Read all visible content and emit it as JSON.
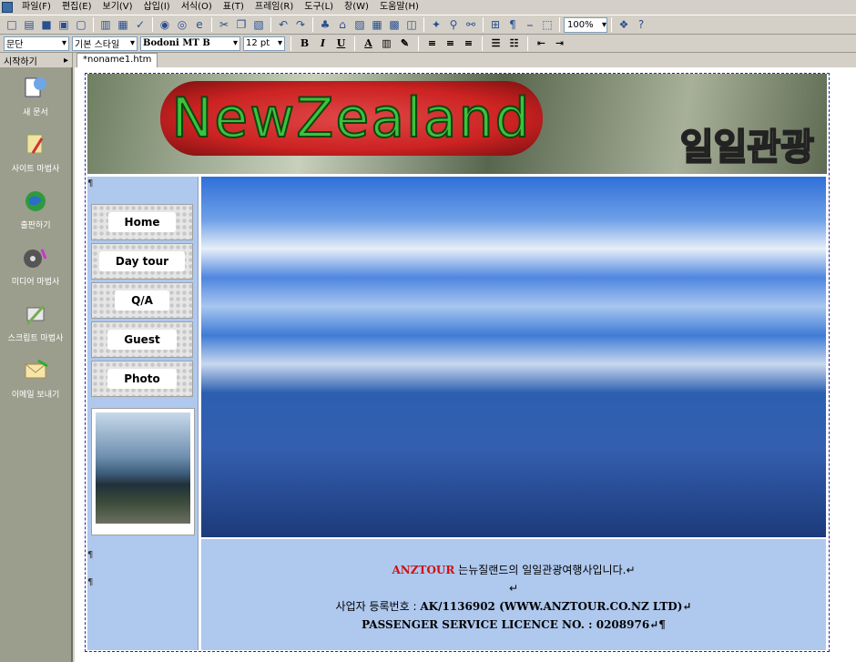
{
  "menu": [
    "파일(F)",
    "편집(E)",
    "보기(V)",
    "삽입(I)",
    "서식(O)",
    "표(T)",
    "프레임(R)",
    "도구(L)",
    "창(W)",
    "도움말(H)"
  ],
  "toolbar": {
    "zoom": "100%"
  },
  "format": {
    "paragraph": "문단",
    "style": "기본 스타일",
    "font": "Bodoni MT B",
    "size": "12 pt",
    "bold": "B",
    "italic": "I",
    "underline": "U"
  },
  "tabs": {
    "start": "시작하기",
    "document": "*noname1.htm"
  },
  "sidebar": [
    {
      "label": "새 문서",
      "icon": "new-document-icon"
    },
    {
      "label": "사이트 마법사",
      "icon": "site-wizard-icon"
    },
    {
      "label": "출판하기",
      "icon": "publish-globe-icon"
    },
    {
      "label": "미디어 마법사",
      "icon": "media-wizard-icon"
    },
    {
      "label": "스크립트 마법사",
      "icon": "script-wizard-icon"
    },
    {
      "label": "이메일 보내기",
      "icon": "email-icon"
    }
  ],
  "banner": {
    "title": "NewZealand",
    "subtitle": "일일관광"
  },
  "nav": [
    "Home",
    "Day tour",
    "Q/A",
    "Guest",
    "Photo"
  ],
  "footer": {
    "brand": "ANZTOUR",
    "line1": " 는뉴질랜드의 일일관광여행사입니다.↵",
    "line2": "↵",
    "line3_label": "사업자 등록번호 : ",
    "line3_value": "AK/1136902 (WWW.ANZTOUR.CO.NZ LTD)↵",
    "line4": "PASSENGER SERVICE LICENCE NO. : 0208976↵¶"
  },
  "colors": {
    "page_bg": "#aec8ee",
    "brand_red": "#d01010",
    "title_green": "#3cc23c"
  }
}
